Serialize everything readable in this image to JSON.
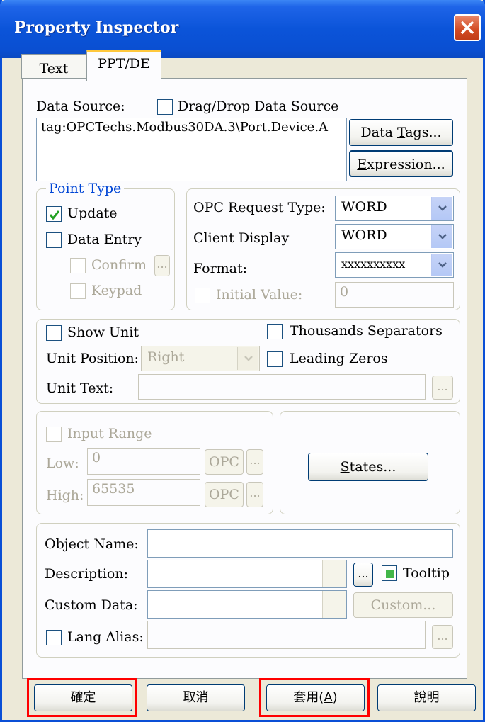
{
  "window": {
    "title": "Property Inspector"
  },
  "tabs": [
    {
      "label": "Text"
    },
    {
      "label": "PPT/DE"
    }
  ],
  "data_source": {
    "label": "Data Source:",
    "dragdrop_label": "Drag/Drop Data Source",
    "value": "tag:OPCTechs.Modbus30DA.3\\Port.Device.A",
    "data_tags_prefix": "Data ",
    "data_tags_key": "T",
    "data_tags_suffix": "ags...",
    "expression_key": "E",
    "expression_suffix": "xpression..."
  },
  "point_type": {
    "legend": "Point Type",
    "update": "Update",
    "data_entry": "Data Entry",
    "confirm": "Confirm",
    "confirm_btn": "...",
    "keypad": "Keypad"
  },
  "opc": {
    "request_type_label": "OPC Request Type:",
    "request_type_value": "WORD",
    "client_display_label": "Client Display",
    "client_display_value": "WORD",
    "format_label": "Format:",
    "format_value": "xxxxxxxxxx",
    "initial_value_label": "Initial Value:",
    "initial_value": "0"
  },
  "unit": {
    "show_unit": "Show Unit",
    "thousands": "Thousands Separators",
    "position_label": "Unit Position:",
    "position_value": "Right",
    "leading_zeros": "Leading Zeros",
    "text_label": "Unit Text:",
    "text_btn": "..."
  },
  "range": {
    "input_range": "Input Range",
    "low_label": "Low:",
    "low_value": "0",
    "high_label": "High:",
    "high_value": "65535",
    "opc_btn": "OPC",
    "dots_btn": "...",
    "states_key": "S",
    "states_suffix": "tates..."
  },
  "object": {
    "name_label": "Object Name:",
    "desc_label": "Description:",
    "desc_btn": "...",
    "tooltip": "Tooltip",
    "custom_data_label": "Custom Data:",
    "custom_btn": "Custom...",
    "lang_alias": "Lang Alias:",
    "lang_btn": "..."
  },
  "footer": {
    "ok": "確定",
    "cancel": "取消",
    "apply_prefix": "套用(",
    "apply_key": "A",
    "apply_suffix": ")",
    "help": "說明"
  },
  "colors": {
    "highlight_box": "#ff0000",
    "title_bar": "#0a54d9",
    "legend": "#0046d5"
  }
}
